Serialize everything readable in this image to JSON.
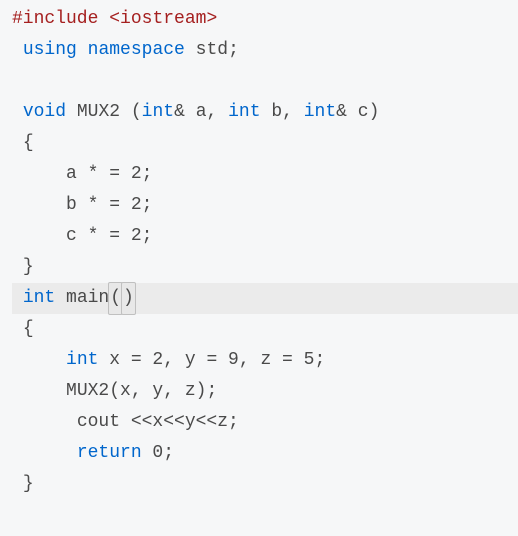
{
  "code": {
    "line1": {
      "include": "#include",
      "path": "<iostream>"
    },
    "line2": {
      "using": "using",
      "namespace": "namespace",
      "std": "std",
      "semi": ";"
    },
    "line3": "",
    "line4": {
      "void": "void",
      "func": "MUX2",
      "lparen": " (",
      "int1": "int",
      "amp1": "&",
      "a": " a",
      "comma1": ", ",
      "int2": "int",
      "b": " b",
      "comma2": ", ",
      "int3": "int",
      "amp2": "&",
      "c": " c",
      "rparen": ")"
    },
    "line5": {
      "brace": "{"
    },
    "line6": {
      "stmt": "a * = 2;"
    },
    "line7": {
      "stmt": "b * = 2;"
    },
    "line8": {
      "stmt": "c * = 2;"
    },
    "line9": {
      "brace": "}"
    },
    "line10": {
      "int": "int",
      "main": " main",
      "lparen": "(",
      "rparen": ")"
    },
    "line11": {
      "brace": "{"
    },
    "line12": {
      "int": "int",
      "rest": " x = 2, y = 9, z = 5;"
    },
    "line13": {
      "stmt": "MUX2(x, y, z);"
    },
    "line14": {
      "cout": "cout <<x<<y<<z;"
    },
    "line15": {
      "return": "return",
      "rest": " 0;"
    },
    "line16": {
      "brace": "}"
    }
  }
}
